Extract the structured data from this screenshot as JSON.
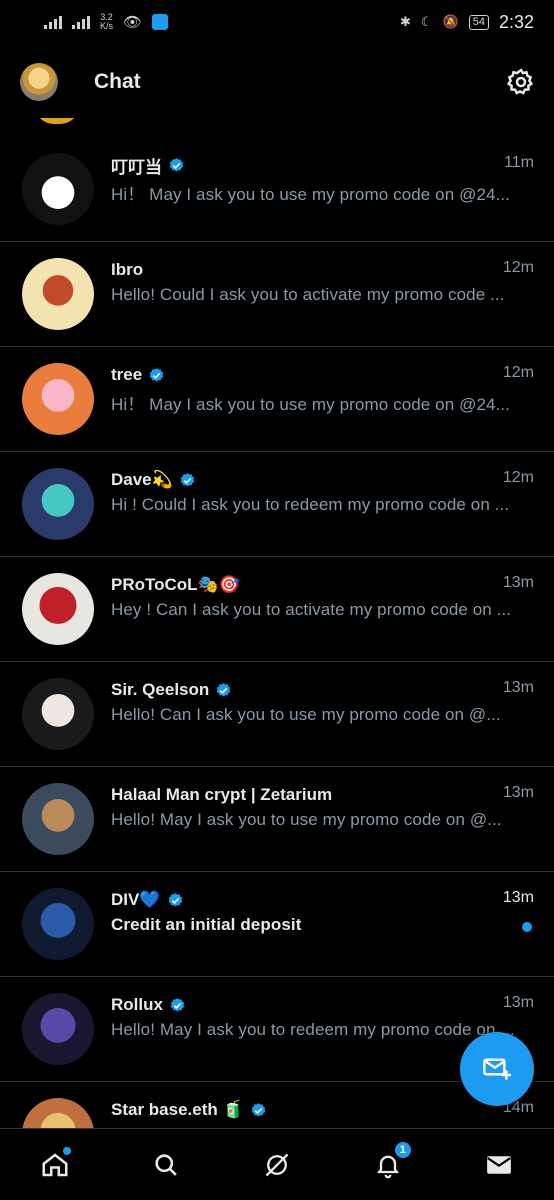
{
  "status_bar": {
    "net_speed_value": "3.2",
    "net_speed_unit": "K/s",
    "battery": "54",
    "time": "2:32"
  },
  "header": {
    "title": "Chat"
  },
  "colors": {
    "accent": "#1d9bf0",
    "background": "#000000",
    "secondary_text": "#8b98a5",
    "divider": "#2f3336"
  },
  "conversations": [
    {
      "name": "叮叮当",
      "verified": true,
      "time": "11m",
      "preview": "Hi！ May I ask you to  use  my promo code on  @24...",
      "unread": false
    },
    {
      "name": "Ibro",
      "verified": false,
      "time": "12m",
      "preview": "Hello! Could I ask you  to activate  my promo code ...",
      "unread": false
    },
    {
      "name": "tree",
      "verified": true,
      "time": "12m",
      "preview": "Hi！ May I ask you to  use  my promo code on  @24...",
      "unread": false
    },
    {
      "name": "Dave💫",
      "verified": true,
      "time": "12m",
      "preview": "Hi ! Could I ask you  to  redeem my promo code on  ...",
      "unread": false
    },
    {
      "name": "PRoToCoL🎭🎯",
      "verified": false,
      "time": "13m",
      "preview": "Hey ! Can I ask you  to activate  my promo code on ...",
      "unread": false
    },
    {
      "name": "Sir. Qeelson",
      "verified": true,
      "time": "13m",
      "preview": "Hello!  Can I ask you  to  use  my promo code on  @...",
      "unread": false
    },
    {
      "name": "Halaal Man crypt | Zetarium",
      "verified": false,
      "time": "13m",
      "preview": "Hello!  May I ask you to  use  my promo code on  @...",
      "unread": false
    },
    {
      "name": "DIV💙",
      "verified": true,
      "time": "13m",
      "preview": "Credit an initial deposit",
      "unread": true
    },
    {
      "name": "Rollux",
      "verified": true,
      "time": "13m",
      "preview": "Hello!  May I ask you to  redeem my promo code on ...",
      "unread": false
    },
    {
      "name": "Star base.eth 🧃",
      "verified": true,
      "time": "14m",
      "preview": "",
      "unread": false
    }
  ],
  "bottom_nav": {
    "notifications_count": "1",
    "items": [
      "home-icon",
      "search-icon",
      "grok-icon",
      "bell-icon",
      "mail-icon"
    ]
  }
}
